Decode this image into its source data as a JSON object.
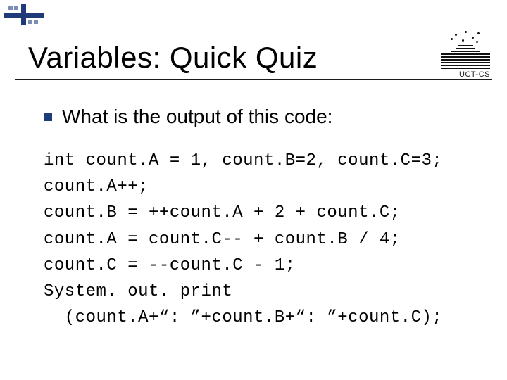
{
  "title": "Variables: Quick Quiz",
  "footer": "UCT-CS",
  "bullet": "What is the output of this code:",
  "code_lines": [
    "int count.A = 1, count.B=2, count.C=3;",
    "count.A++;",
    "count.B = ++count.A + 2 + count.C;",
    "count.A = count.C-- + count.B / 4;",
    "count.C = --count.C - 1;",
    "System. out. print",
    "  (count.A+“: ”+count.B+“: ”+count.C);"
  ]
}
